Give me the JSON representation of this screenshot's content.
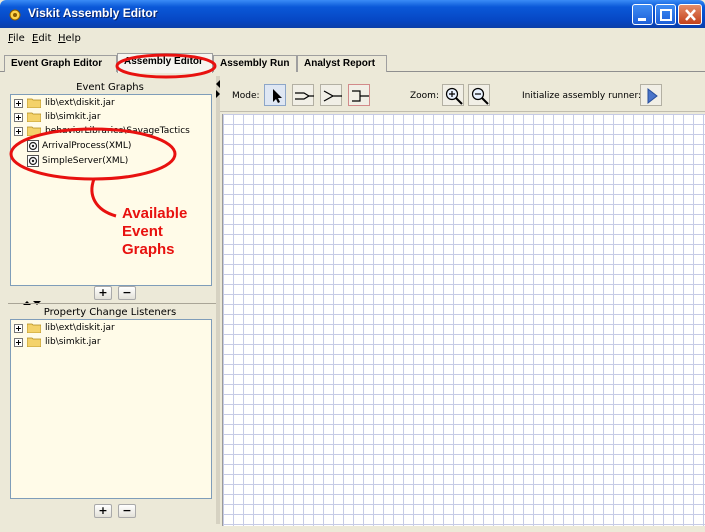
{
  "window": {
    "title": "Viskit Assembly Editor"
  },
  "menu": {
    "items": [
      {
        "label": "ile",
        "mnemonic": "F"
      },
      {
        "label": "dit",
        "mnemonic": "E"
      },
      {
        "label": "elp",
        "mnemonic": "H"
      }
    ]
  },
  "tabs": [
    {
      "label": "Event Graph Editor",
      "active": false
    },
    {
      "label": "Assembly Editor",
      "active": true
    },
    {
      "label": "Assembly Run",
      "active": false
    },
    {
      "label": "Analyst Report",
      "active": false
    }
  ],
  "event_graphs": {
    "title": "Event Graphs",
    "nodes": [
      {
        "label": "lib\\ext\\diskit.jar",
        "icon": "folder-icon"
      },
      {
        "label": "lib\\simkit.jar",
        "icon": "folder-icon"
      },
      {
        "label": "behaviorLibraries\\SavageTactics",
        "icon": "folder-icon"
      },
      {
        "label": "ArrivalProcess(XML)",
        "icon": "event-graph-icon"
      },
      {
        "label": "SimpleServer(XML)",
        "icon": "event-graph-icon"
      }
    ],
    "add_label": "+",
    "remove_label": "−"
  },
  "property_change_listeners": {
    "title": "Property Change Listeners",
    "nodes": [
      {
        "label": "lib\\ext\\diskit.jar",
        "icon": "folder-icon"
      },
      {
        "label": "lib\\simkit.jar",
        "icon": "folder-icon"
      }
    ],
    "add_label": "+",
    "remove_label": "−"
  },
  "toolbar": {
    "mode_label": "Mode:",
    "mode_buttons": [
      "select-mode-icon",
      "adapter-mode-icon",
      "sim-event-listener-mode-icon",
      "property-change-listener-mode-icon"
    ],
    "zoom_label": "Zoom:",
    "zoom_buttons": [
      "zoom-in-icon",
      "zoom-out-icon"
    ],
    "init_label": "Initialize assembly runner:",
    "init_button": "play-icon"
  },
  "annotation": {
    "lines": [
      "Available",
      "Event",
      "Graphs"
    ],
    "color": "#e8110f"
  },
  "colors": {
    "title_bar": "#0646c3",
    "tree_background": "#fffbe8",
    "grid_line": "#c6cbe6",
    "annotation": "#e8110f"
  }
}
